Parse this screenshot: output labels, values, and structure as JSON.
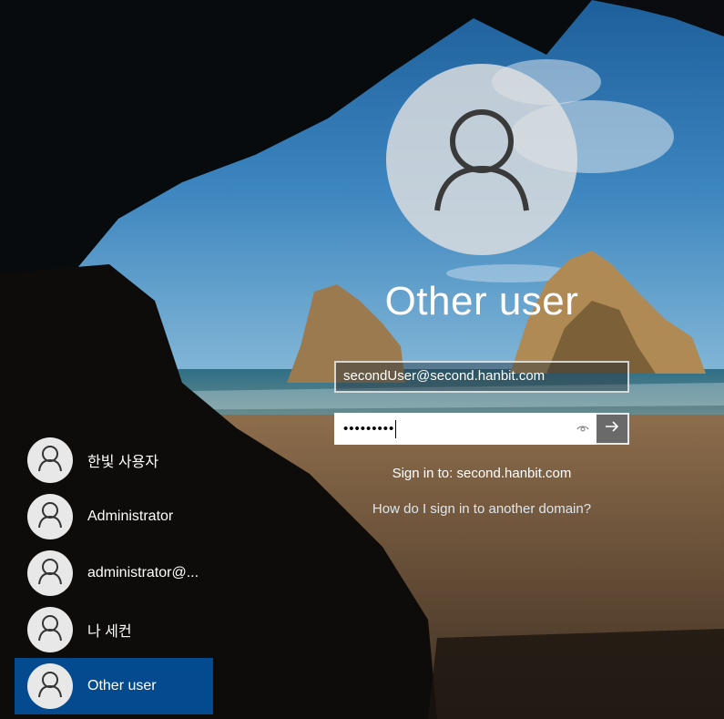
{
  "selected_user": {
    "display_name": "Other user",
    "avatar_icon": "user-silhouette-icon"
  },
  "form": {
    "username_value": "secondUser@second.hanbit.com",
    "password_mask": "•••••••••",
    "reveal_icon": "eye-icon",
    "submit_icon": "arrow-right-icon"
  },
  "sign_in_to": "Sign in to: second.hanbit.com",
  "other_domain_link": "How do I sign in to another domain?",
  "users": [
    {
      "name": "한빛 사용자",
      "selected": false
    },
    {
      "name": "Administrator",
      "selected": false
    },
    {
      "name": "administrator@...",
      "selected": false
    },
    {
      "name": "나 세컨",
      "selected": false
    },
    {
      "name": "Other user",
      "selected": true
    }
  ],
  "colors": {
    "selected_highlight": "#034a8f",
    "avatar_bg": "#e8e8e8",
    "text": "#ffffff"
  }
}
